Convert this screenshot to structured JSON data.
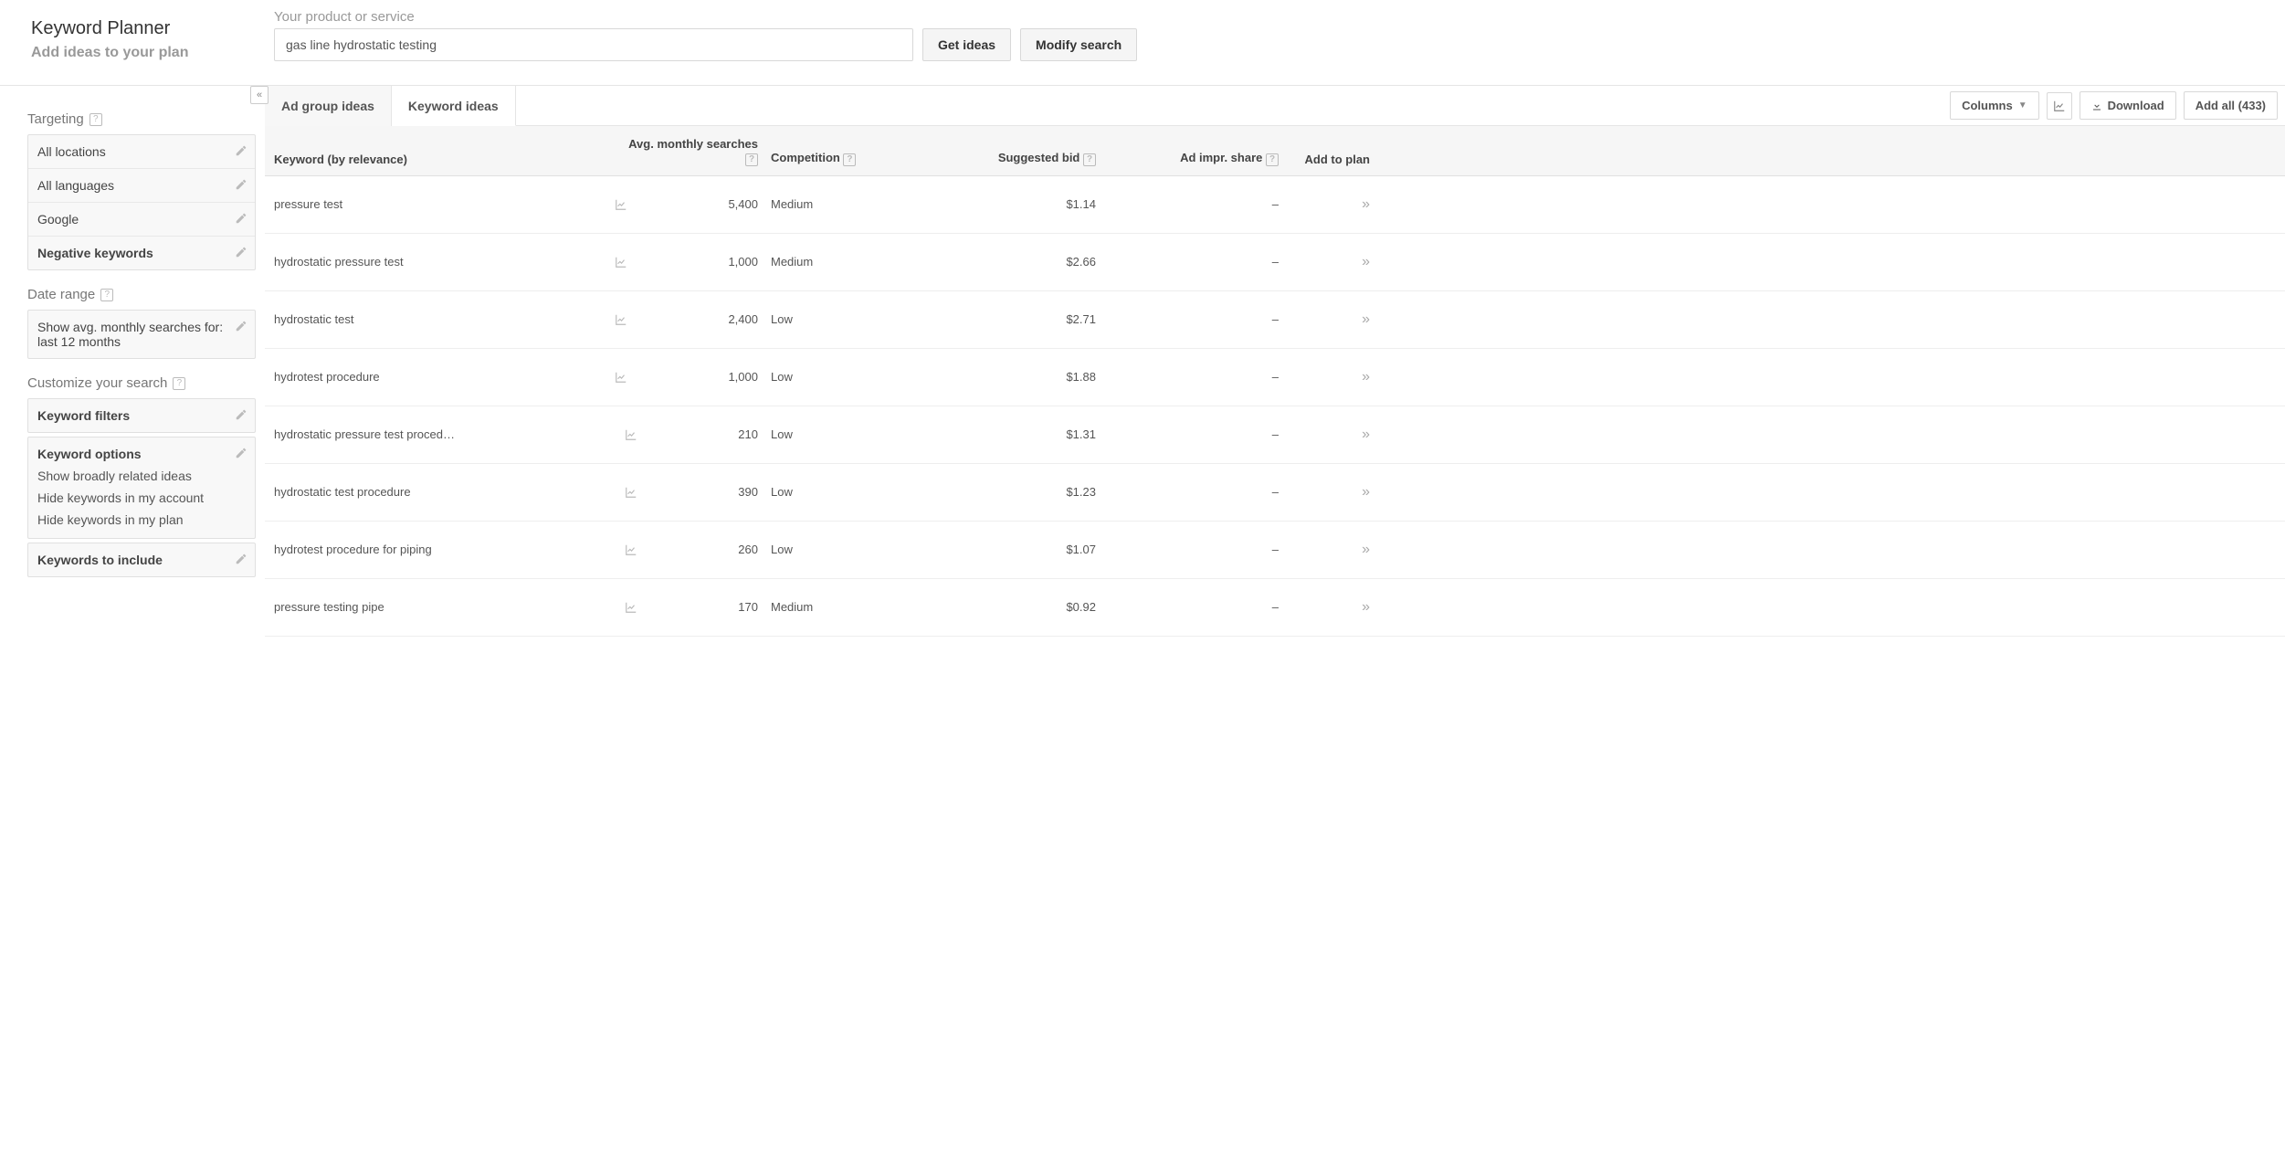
{
  "header": {
    "title": "Keyword Planner",
    "subtitle": "Add ideas to your plan",
    "search_label": "Your product or service",
    "search_value": "gas line hydrostatic testing",
    "get_ideas": "Get ideas",
    "modify_search": "Modify search"
  },
  "sidebar": {
    "targeting_heading": "Targeting",
    "targeting": [
      {
        "label": "All locations",
        "bold": false
      },
      {
        "label": "All languages",
        "bold": false
      },
      {
        "label": "Google",
        "bold": false
      },
      {
        "label": "Negative keywords",
        "bold": true
      }
    ],
    "date_heading": "Date range",
    "date_text": "Show avg. monthly searches for: last 12 months",
    "customize_heading": "Customize your search",
    "filters_label": "Keyword filters",
    "options_label": "Keyword options",
    "options_lines": [
      "Show broadly related ideas",
      "Hide keywords in my account",
      "Hide keywords in my plan"
    ],
    "include_label": "Keywords to include"
  },
  "toolbar": {
    "tab_group": "Ad group ideas",
    "tab_keyword": "Keyword ideas",
    "columns": "Columns",
    "download": "Download",
    "add_all": "Add all (433)"
  },
  "table": {
    "headers": {
      "keyword": "Keyword (by relevance)",
      "searches": "Avg. monthly searches",
      "competition": "Competition",
      "bid": "Suggested bid",
      "impr": "Ad impr. share",
      "add": "Add to plan"
    },
    "rows": [
      {
        "keyword": "pressure test",
        "searches": "5,400",
        "competition": "Medium",
        "bid": "$1.14",
        "impr": "–"
      },
      {
        "keyword": "hydrostatic pressure test",
        "searches": "1,000",
        "competition": "Medium",
        "bid": "$2.66",
        "impr": "–"
      },
      {
        "keyword": "hydrostatic test",
        "searches": "2,400",
        "competition": "Low",
        "bid": "$2.71",
        "impr": "–"
      },
      {
        "keyword": "hydrotest procedure",
        "searches": "1,000",
        "competition": "Low",
        "bid": "$1.88",
        "impr": "–"
      },
      {
        "keyword": "hydrostatic pressure test proced…",
        "searches": "210",
        "competition": "Low",
        "bid": "$1.31",
        "impr": "–"
      },
      {
        "keyword": "hydrostatic test procedure",
        "searches": "390",
        "competition": "Low",
        "bid": "$1.23",
        "impr": "–"
      },
      {
        "keyword": "hydrotest procedure for piping",
        "searches": "260",
        "competition": "Low",
        "bid": "$1.07",
        "impr": "–"
      },
      {
        "keyword": "pressure testing pipe",
        "searches": "170",
        "competition": "Medium",
        "bid": "$0.92",
        "impr": "–"
      }
    ]
  }
}
